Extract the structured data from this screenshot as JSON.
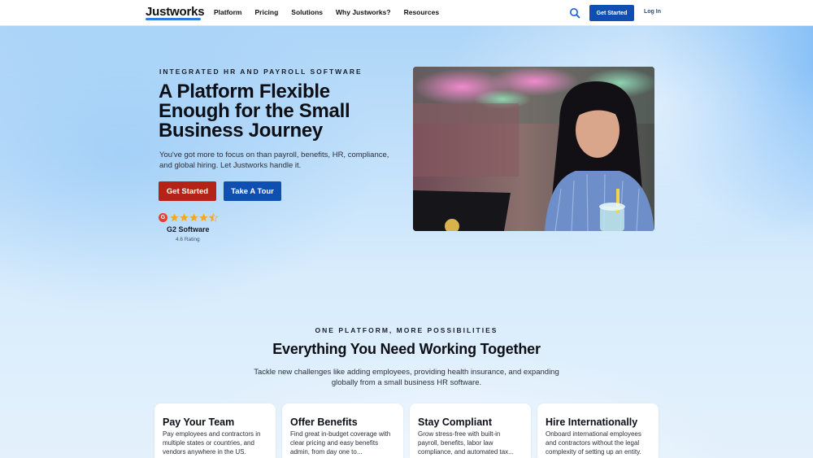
{
  "header": {
    "logo": "Justworks",
    "nav": [
      "Platform",
      "Pricing",
      "Solutions",
      "Why Justworks?",
      "Resources"
    ],
    "cta": "Get Started",
    "login": "Log In"
  },
  "hero": {
    "eyebrow": "INTEGRATED HR AND PAYROLL SOFTWARE",
    "title": "A Platform Flexible Enough for the Small Business Journey",
    "subtitle": "You've got more to focus on than payroll, benefits, HR, compliance, and global hiring. Let Justworks handle it.",
    "primary_cta": "Get Started",
    "secondary_cta": "Take A Tour",
    "g2": {
      "badge": "G",
      "label": "G2 Software",
      "rating_text": "4.6 Rating",
      "stars": 4.5
    }
  },
  "section": {
    "eyebrow": "ONE PLATFORM, MORE POSSIBILITIES",
    "title": "Everything You Need Working Together",
    "subtitle": "Tackle new challenges like adding employees, providing health insurance, and expanding globally from a small business HR software."
  },
  "cards": [
    {
      "title": "Pay Your Team",
      "desc": "Pay employees and contractors in multiple states or countries, and vendors anywhere in the US."
    },
    {
      "title": "Offer Benefits",
      "desc": "Find great in-budget coverage with clear pricing and easy benefits admin, from day one to..."
    },
    {
      "title": "Stay Compliant",
      "desc": "Grow stress-free with built-in payroll, benefits, labor law compliance, and automated tax..."
    },
    {
      "title": "Hire Internationally",
      "desc": "Onboard international employees and contractors without the legal complexity of setting up an entity."
    }
  ],
  "colors": {
    "brand_blue": "#0f4fb1",
    "cta_red": "#b42316",
    "g2_red": "#ef3b2d",
    "star_yellow": "#f5a623"
  }
}
